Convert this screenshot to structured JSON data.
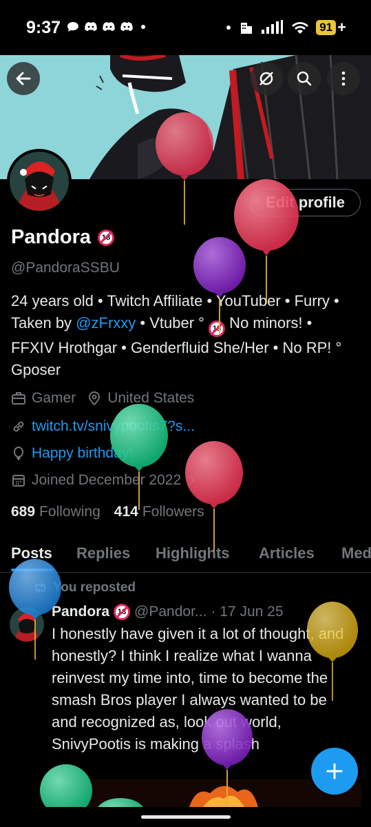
{
  "status_bar": {
    "time": "9:37",
    "battery": "91",
    "battery_plus": "+"
  },
  "header": {
    "back_label": "Back",
    "more_label": "More"
  },
  "profile": {
    "edit_button": "Edit profile",
    "name": "Pandora",
    "name_emoji": "18",
    "handle": "@PandoraSSBU",
    "bio_part1": "24 years old • Twitch Affiliate • YouTuber • Furry • Taken by ",
    "bio_mention": "@zFrxxy",
    "bio_part2": " • Vtuber ° ",
    "bio_part3": " No minors! • FFXIV Hrothgar • Genderfluid She/Her  • No RP! ° Gposer",
    "category": "Gamer",
    "location": "United States",
    "website": "twitch.tv/snivypootis7?s...",
    "birthday": "Happy birthday!",
    "joined": "Joined December 2022",
    "following_count": "689",
    "following_label": "Following",
    "followers_count": "414",
    "followers_label": "Followers"
  },
  "tabs": [
    "Posts",
    "Replies",
    "Highlights",
    "Articles",
    "Med"
  ],
  "post": {
    "repost_label": "You reposted",
    "author": "Pandora",
    "author_handle": "@Pandor...",
    "date": "· 17 Jun 25",
    "text": "I honestly have given it a lot of thought, and honestly? I think I realize what I wanna reinvest my time into, time to become the smash Bros player I always wanted to be and recognized as, look out world, SnivyPootis is making a splash"
  },
  "colors": {
    "accent": "#1d9bf0",
    "muted": "#71767b",
    "balloon_red": "#e8445f",
    "balloon_purple": "#8b2fc9",
    "balloon_green": "#1fcf8c",
    "balloon_blue": "#2a8ee0",
    "balloon_yellow": "#e3b90f"
  }
}
